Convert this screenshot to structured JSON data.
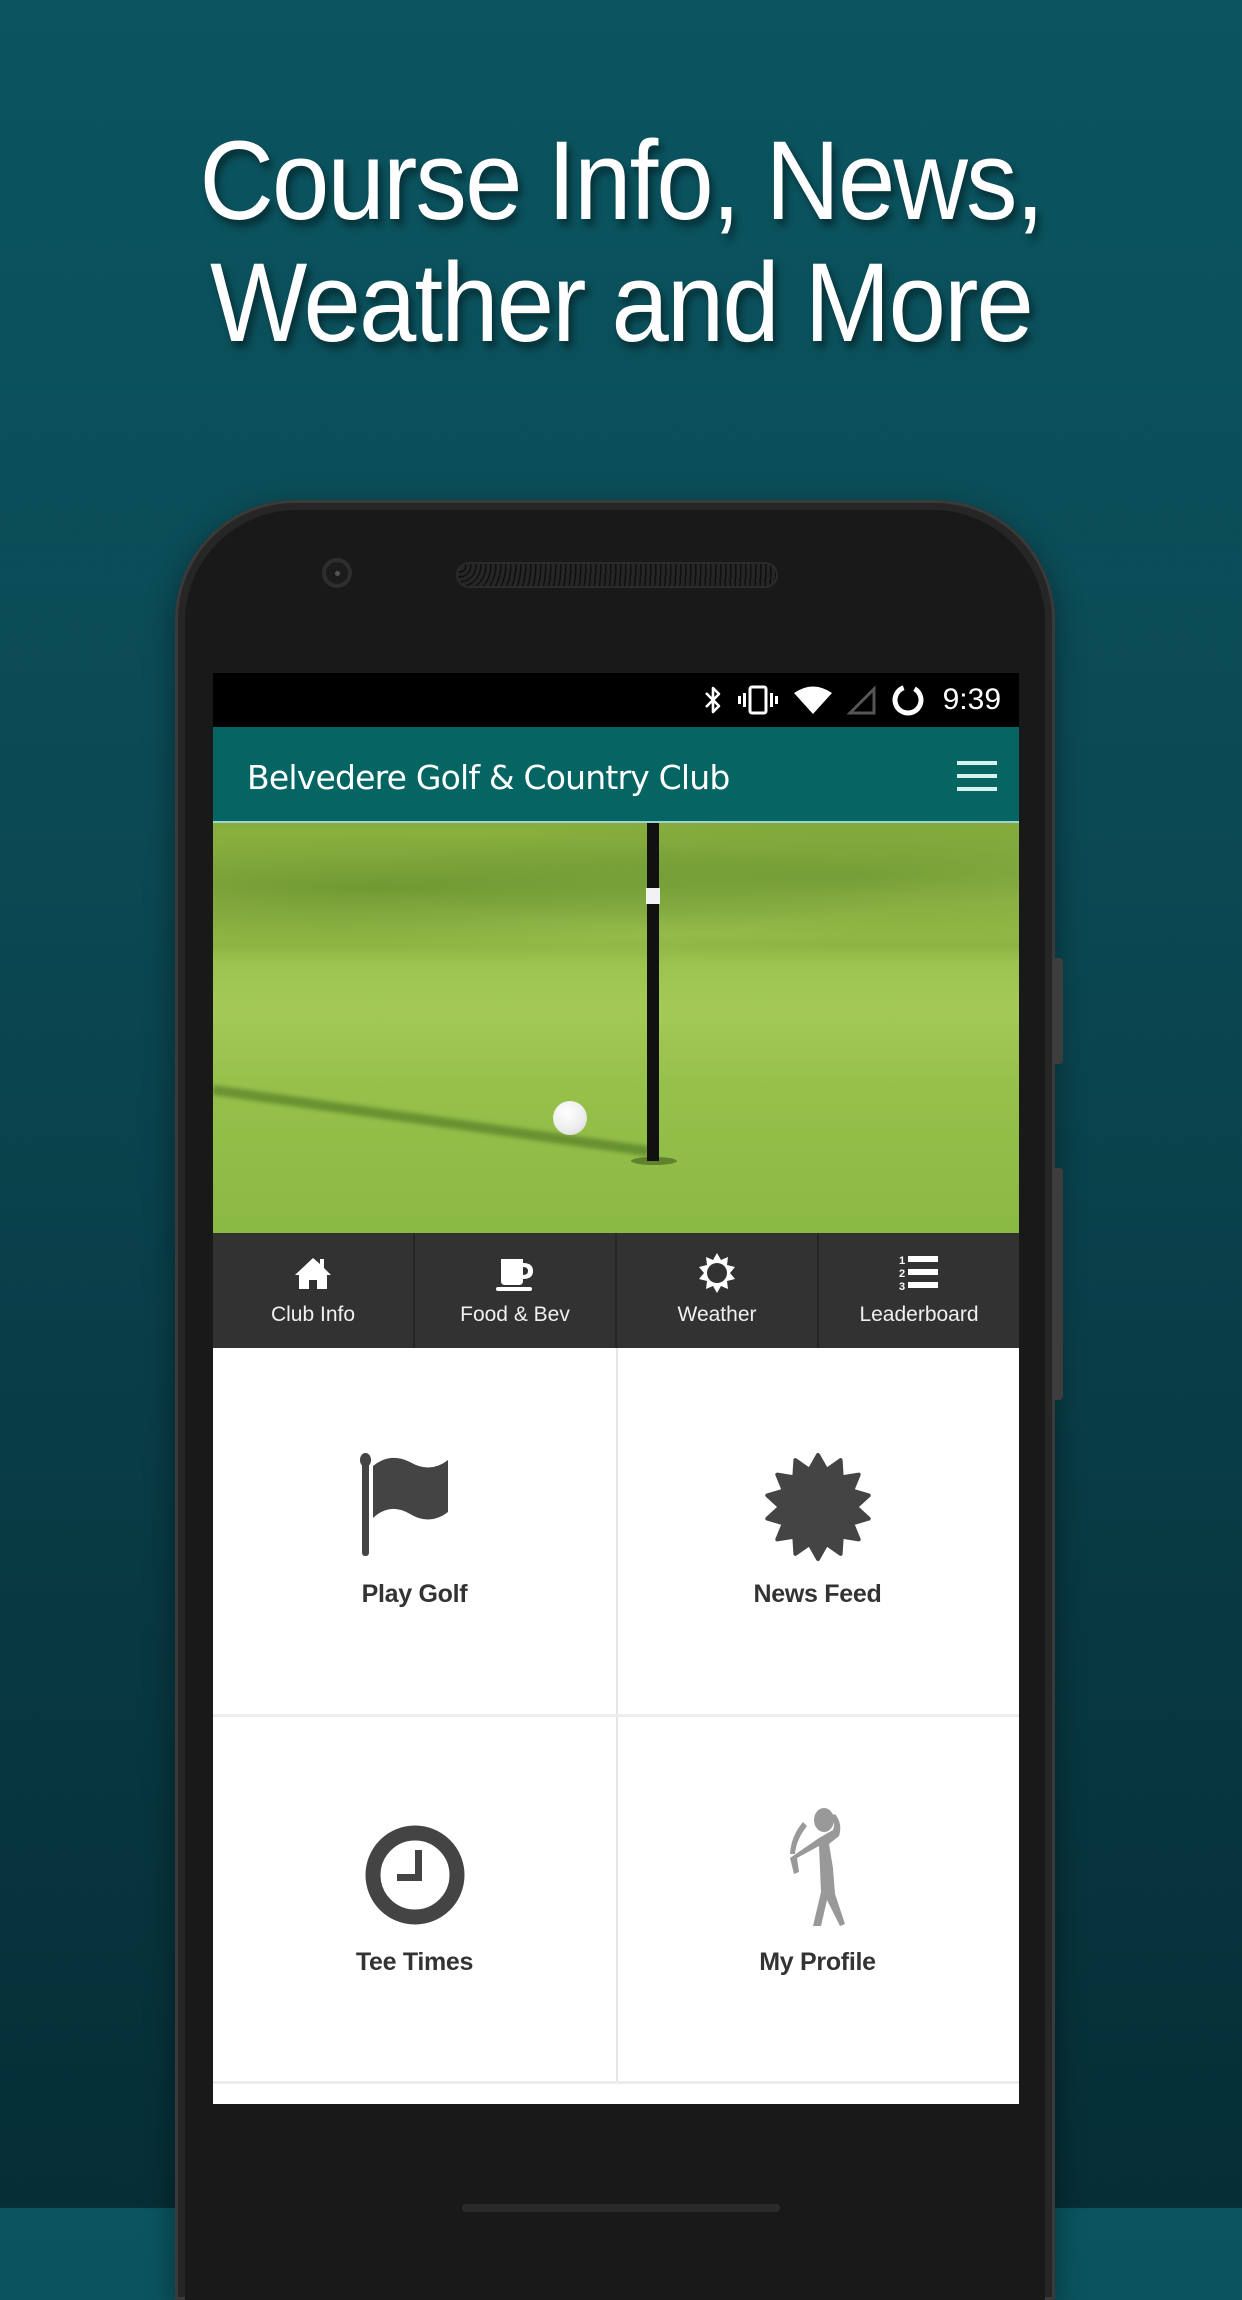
{
  "promo": {
    "headline_line1": "Course Info, News,",
    "headline_line2": "Weather and More"
  },
  "status_bar": {
    "icons": [
      "bluetooth-icon",
      "vibrate-icon",
      "wifi-icon",
      "cell-signal-icon",
      "battery-charging-icon"
    ],
    "time": "9:39"
  },
  "app_bar": {
    "title": "Belvedere Golf & Country Club",
    "menu_icon": "hamburger-menu-icon",
    "color": "#046563"
  },
  "hero": {
    "description": "Golf ball next to flagstick on putting green"
  },
  "quick_nav": {
    "items": [
      {
        "label": "Club Info",
        "icon": "home-icon"
      },
      {
        "label": "Food & Bev",
        "icon": "coffee-cup-icon"
      },
      {
        "label": "Weather",
        "icon": "sun-icon"
      },
      {
        "label": "Leaderboard",
        "icon": "numbered-list-icon"
      }
    ]
  },
  "tiles": [
    {
      "label": "Play Golf",
      "icon": "flag-icon"
    },
    {
      "label": "News Feed",
      "icon": "badge-icon"
    },
    {
      "label": "Tee Times",
      "icon": "clock-icon"
    },
    {
      "label": "My Profile",
      "icon": "golfer-icon"
    }
  ]
}
